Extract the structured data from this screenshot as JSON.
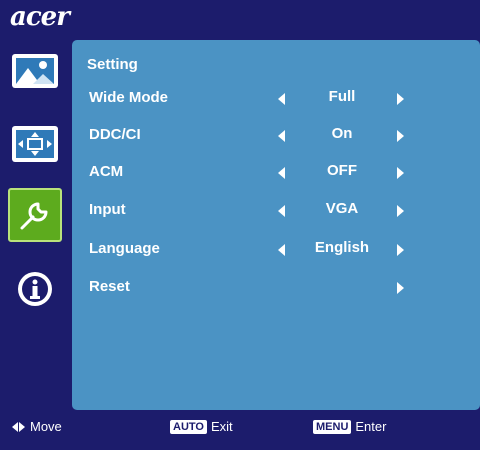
{
  "brand": {
    "logo_text": "acer"
  },
  "sidebar": {
    "items": [
      {
        "name": "picture",
        "icon": "picture-icon",
        "selected": false
      },
      {
        "name": "position",
        "icon": "position-icon",
        "selected": false
      },
      {
        "name": "setting",
        "icon": "wrench-icon",
        "selected": true
      },
      {
        "name": "information",
        "icon": "info-icon",
        "selected": false
      }
    ]
  },
  "panel": {
    "title": "Setting",
    "rows": [
      {
        "label": "Wide Mode",
        "value": "Full",
        "left_arrow": true
      },
      {
        "label": "DDC/CI",
        "value": "On",
        "left_arrow": true
      },
      {
        "label": "ACM",
        "value": "OFF",
        "left_arrow": true
      },
      {
        "label": "Input",
        "value": "VGA",
        "left_arrow": true
      },
      {
        "label": "Language",
        "value": "English",
        "left_arrow": true
      },
      {
        "label": "Reset",
        "value": "",
        "left_arrow": false
      }
    ]
  },
  "footer": {
    "move_label": "Move",
    "auto_key": "AUTO",
    "exit_label": "Exit",
    "menu_key": "MENU",
    "enter_label": "Enter"
  },
  "colors": {
    "background": "#1c1c6c",
    "panel": "#4b93c4",
    "selected": "#5dab1e",
    "icon_tile": "#2f7ab8"
  }
}
